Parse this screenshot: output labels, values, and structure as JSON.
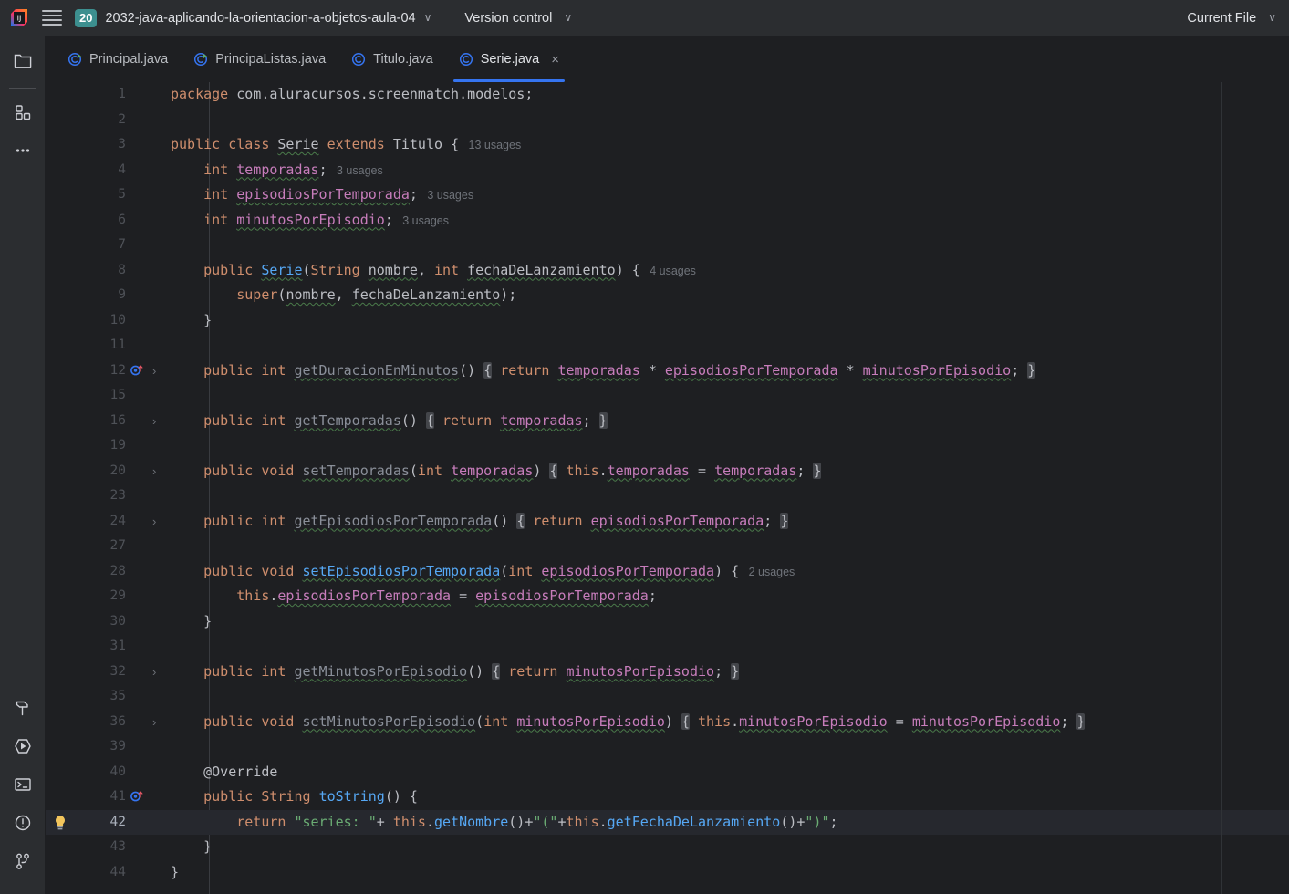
{
  "titlebar": {
    "logo_icon": "intellij-idea-logo",
    "menu_icon": "hamburger-menu-icon",
    "project_badge": "20",
    "project_name": "2032-java-aplicando-la-orientacion-a-objetos-aula-04",
    "project_chevron": "∨",
    "version_control": "Version control",
    "version_control_chevron": "∨",
    "current_file": "Current File",
    "current_file_chevron": "∨"
  },
  "rail": {
    "top_items": [
      {
        "name": "project-tool-window",
        "icon": "folder-icon",
        "tooltip": "Project"
      },
      {
        "name": "commit-tool-window",
        "icon": "commit-squares-icon",
        "tooltip": "Commit"
      },
      {
        "name": "more-tool-windows",
        "icon": "ellipsis-icon",
        "tooltip": "More tool windows"
      }
    ],
    "bottom_items": [
      {
        "name": "build-tool-window",
        "icon": "hammer-icon",
        "tooltip": "Build"
      },
      {
        "name": "run-tool-window",
        "icon": "run-play-icon",
        "tooltip": "Run"
      },
      {
        "name": "terminal-tool-window",
        "icon": "terminal-icon",
        "tooltip": "Terminal"
      },
      {
        "name": "problems-tool-window",
        "icon": "exclamation-circle-icon",
        "tooltip": "Problems"
      },
      {
        "name": "git-tool-window",
        "icon": "git-branch-icon",
        "tooltip": "Git"
      }
    ]
  },
  "tabs": [
    {
      "label": "Principal.java",
      "icon": "java-class-run-icon",
      "active": false,
      "closable": false
    },
    {
      "label": "PrincipaListas.java",
      "icon": "java-class-run-icon",
      "active": false,
      "closable": false
    },
    {
      "label": "Titulo.java",
      "icon": "java-class-icon",
      "active": false,
      "closable": false
    },
    {
      "label": "Serie.java",
      "icon": "java-class-icon",
      "active": true,
      "closable": true,
      "close_glyph": "×"
    }
  ],
  "editor": {
    "file": "Serie.java",
    "current_line": 42,
    "line_numbers": [
      1,
      2,
      3,
      4,
      5,
      6,
      7,
      8,
      9,
      10,
      11,
      12,
      15,
      16,
      19,
      20,
      23,
      24,
      27,
      28,
      29,
      30,
      31,
      32,
      35,
      36,
      39,
      40,
      41,
      42,
      43,
      44
    ],
    "gutter_markers": {
      "12": "overriding-method-icon",
      "41": "overriding-method-icon",
      "42": "intention-bulb-icon"
    },
    "fold_arrows": [
      12,
      16,
      20,
      24,
      32,
      36
    ],
    "lines": [
      {
        "n": 1,
        "text": "package com.aluracursos.screenmatch.modelos;"
      },
      {
        "n": 2,
        "text": ""
      },
      {
        "n": 3,
        "text": "public class Serie extends Titulo {",
        "hint": "13 usages"
      },
      {
        "n": 4,
        "text": "    int temporadas;",
        "hint": "3 usages"
      },
      {
        "n": 5,
        "text": "    int episodiosPorTemporada;",
        "hint": "3 usages"
      },
      {
        "n": 6,
        "text": "    int minutosPorEpisodio;",
        "hint": "3 usages"
      },
      {
        "n": 7,
        "text": ""
      },
      {
        "n": 8,
        "text": "    public Serie(String nombre, int fechaDeLanzamiento) {",
        "hint": "4 usages"
      },
      {
        "n": 9,
        "text": "        super(nombre, fechaDeLanzamiento);"
      },
      {
        "n": 10,
        "text": "    }"
      },
      {
        "n": 11,
        "text": ""
      },
      {
        "n": 12,
        "text": "    public int getDuracionEnMinutos() { return temporadas * episodiosPorTemporada * minutosPorEpisodio; }",
        "folded": true
      },
      {
        "n": 15,
        "text": ""
      },
      {
        "n": 16,
        "text": "    public int getTemporadas() { return temporadas; }",
        "folded": true
      },
      {
        "n": 19,
        "text": ""
      },
      {
        "n": 20,
        "text": "    public void setTemporadas(int temporadas) { this.temporadas = temporadas; }",
        "folded": true
      },
      {
        "n": 23,
        "text": ""
      },
      {
        "n": 24,
        "text": "    public int getEpisodiosPorTemporada() { return episodiosPorTemporada; }",
        "folded": true
      },
      {
        "n": 27,
        "text": ""
      },
      {
        "n": 28,
        "text": "    public void setEpisodiosPorTemporada(int episodiosPorTemporada) {",
        "hint": "2 usages"
      },
      {
        "n": 29,
        "text": "        this.episodiosPorTemporada = episodiosPorTemporada;"
      },
      {
        "n": 30,
        "text": "    }"
      },
      {
        "n": 31,
        "text": ""
      },
      {
        "n": 32,
        "text": "    public int getMinutosPorEpisodio() { return minutosPorEpisodio; }",
        "folded": true
      },
      {
        "n": 35,
        "text": ""
      },
      {
        "n": 36,
        "text": "    public void setMinutosPorEpisodio(int minutosPorEpisodio) { this.minutosPorEpisodio = minutosPorEpisodio; }",
        "folded": true
      },
      {
        "n": 39,
        "text": ""
      },
      {
        "n": 40,
        "text": "    @Override"
      },
      {
        "n": 41,
        "text": "    public String toString() {"
      },
      {
        "n": 42,
        "text": "        return \"series: \"+ this.getNombre()+\"(\"+this.getFechaDeLanzamiento()+\")\";"
      },
      {
        "n": 43,
        "text": "    }"
      },
      {
        "n": 44,
        "text": "}"
      }
    ]
  },
  "colors": {
    "background": "#1e1f22",
    "chrome": "#2b2d30",
    "accent": "#3574f0",
    "keyword": "#cf8e6d",
    "method": "#56a8f5",
    "field": "#c77dbb",
    "string": "#6aab73",
    "annotation": "#b3ae60",
    "plain": "#bcbec4",
    "hint": "#6f737a",
    "badge": "#3c8f8f"
  }
}
